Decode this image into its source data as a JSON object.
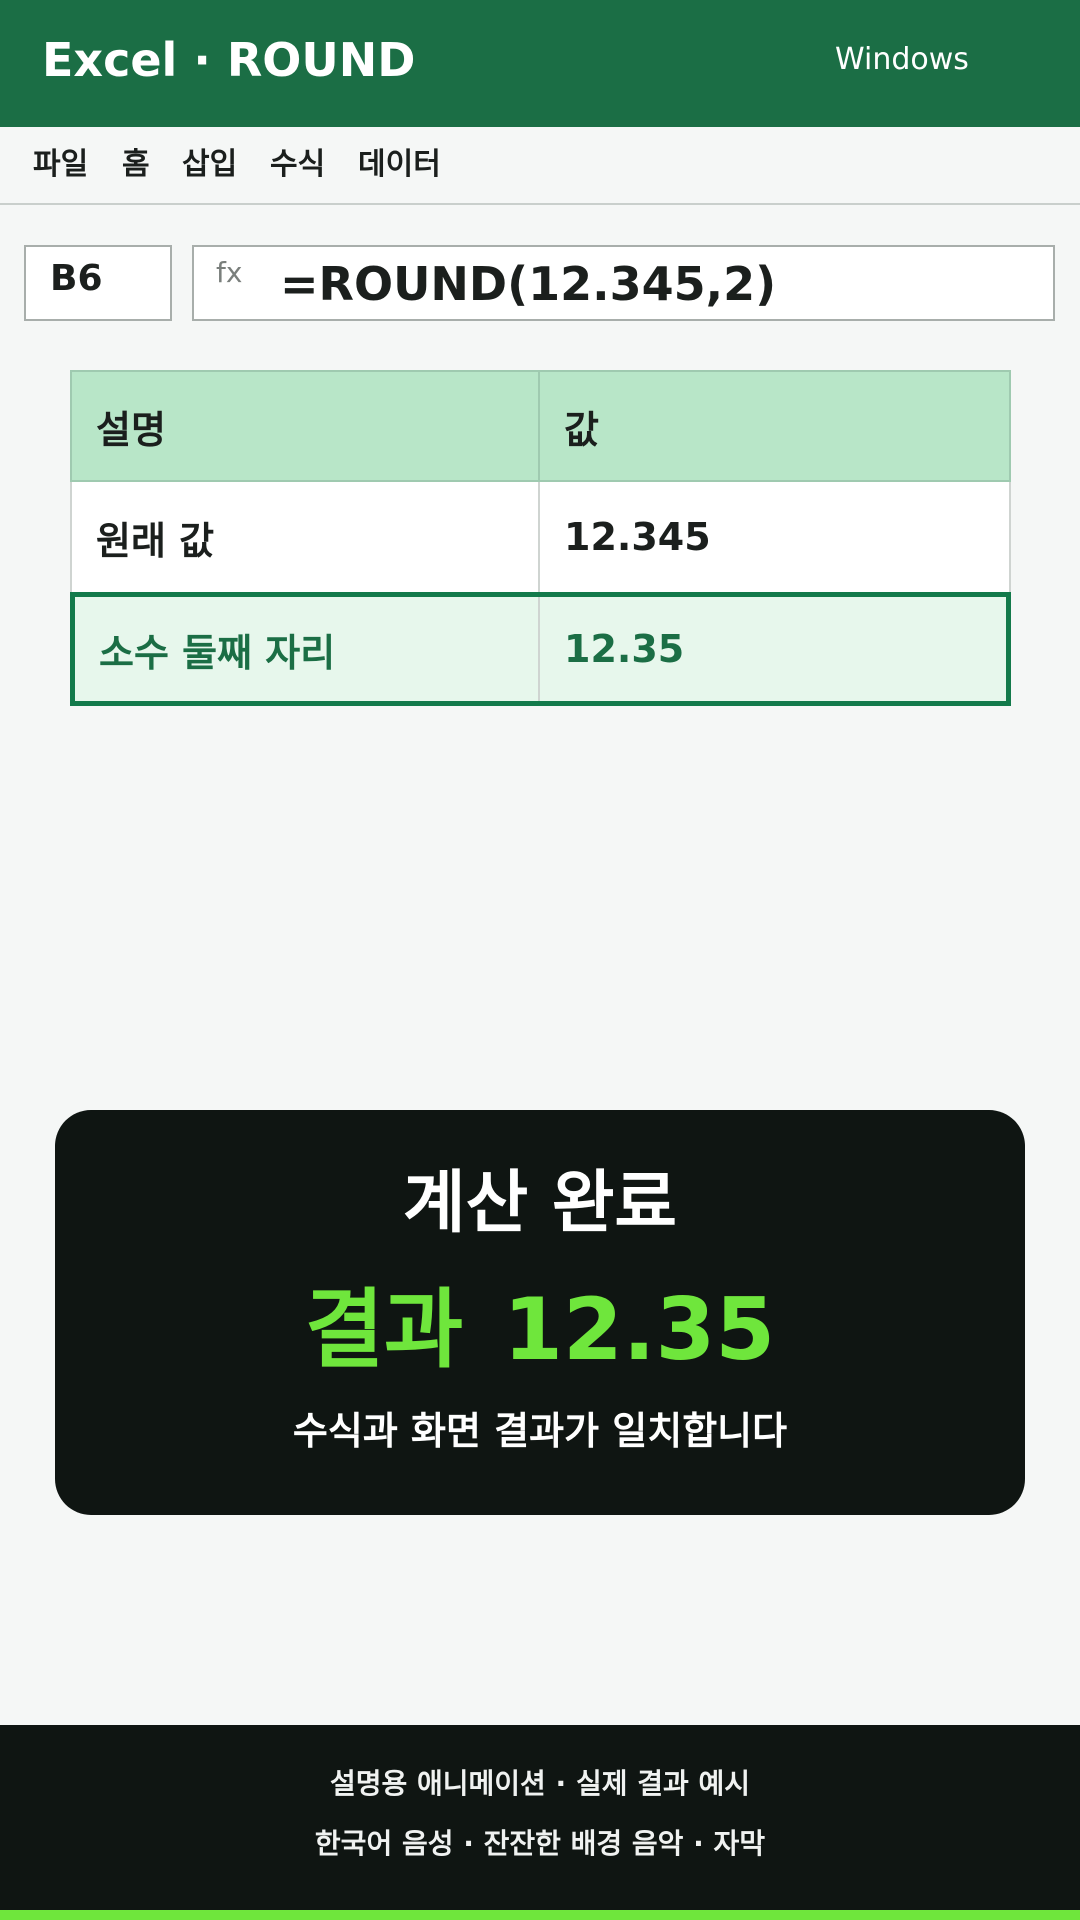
{
  "titlebar": {
    "app_title": "Excel · ROUND",
    "os_label": "Windows"
  },
  "menu": [
    "파일",
    "홈",
    "삽입",
    "수식",
    "데이터"
  ],
  "formula_bar": {
    "name_box": "B6",
    "fx_label": "fx",
    "formula": "=ROUND(12.345,2)"
  },
  "table": {
    "headers": [
      "설명",
      "값"
    ],
    "rows": [
      [
        "원래 값",
        "12.345"
      ],
      [
        "소수 둘째 자리",
        "12.35"
      ]
    ],
    "selected_row": 1
  },
  "result_card": {
    "title": "계산 완료",
    "result_label": "결과",
    "result_value": "12.35",
    "note": "수식과 화면 결과가 일치합니다"
  },
  "footer": {
    "line1": "설명용 애니메이션 · 실제 결과 예시",
    "line2": "한국어 음성 · 잔잔한 배경 음악 · 자막"
  },
  "progress": {
    "fraction": 1.0
  },
  "colors": {
    "brand_green": "#1b6e45",
    "header_fill": "#b8e6c8",
    "selected_fill": "#e7f7ec",
    "accent_lime": "#6fe63c",
    "card_bg": "#0f1512"
  }
}
